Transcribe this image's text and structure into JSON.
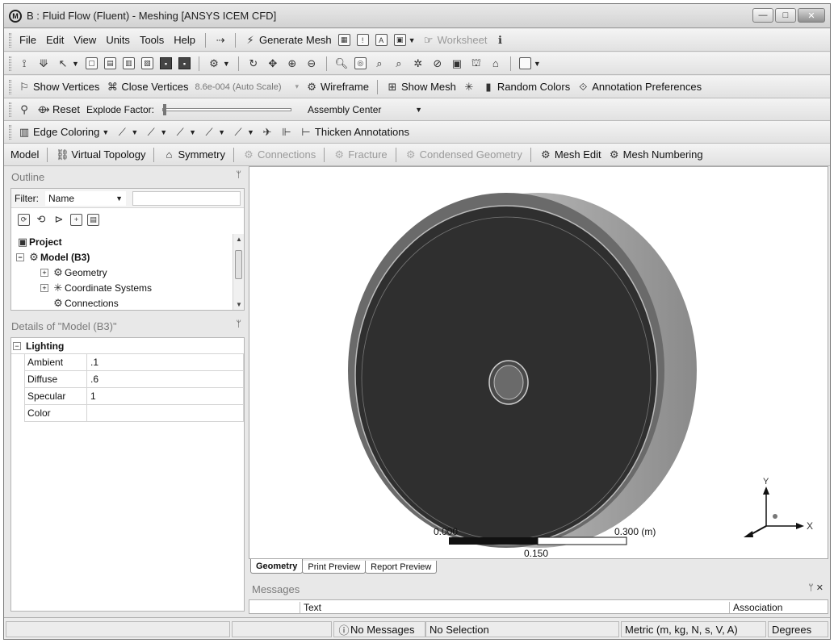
{
  "window": {
    "title": "B : Fluid Flow (Fluent) - Meshing [ANSYS ICEM CFD]",
    "app_icon": "M",
    "controls": [
      "—",
      "□",
      "✕"
    ]
  },
  "menu": {
    "items": [
      "File",
      "Edit",
      "View",
      "Units",
      "Tools",
      "Help"
    ],
    "generate_mesh": "Generate Mesh",
    "worksheet": "Worksheet"
  },
  "toolbar_display": {
    "show_vertices": "Show Vertices",
    "close_vertices": "Close Vertices",
    "scale_value": "8.6e-004 (Auto Scale)",
    "wireframe": "Wireframe",
    "show_mesh": "Show Mesh",
    "random_colors": "Random Colors",
    "annotation_prefs": "Annotation Preferences"
  },
  "toolbar_explode": {
    "reset": "Reset",
    "explode_factor": "Explode Factor:",
    "center_option": "Assembly Center"
  },
  "toolbar_edge": {
    "edge_coloring": "Edge Coloring",
    "thicken_annotations": "Thicken Annotations"
  },
  "context_toolbar": {
    "model": "Model",
    "virtual_topology": "Virtual Topology",
    "symmetry": "Symmetry",
    "connections": "Connections",
    "fracture": "Fracture",
    "condensed_geometry": "Condensed Geometry",
    "mesh_edit": "Mesh Edit",
    "mesh_numbering": "Mesh Numbering"
  },
  "outline": {
    "title": "Outline",
    "filter_label": "Filter:",
    "filter_value": "Name",
    "tree": {
      "project": "Project",
      "model": "Model (B3)",
      "geometry": "Geometry",
      "coordinate_systems": "Coordinate Systems",
      "connections": "Connections"
    }
  },
  "details": {
    "title": "Details of \"Model (B3)\"",
    "group": "Lighting",
    "rows": [
      {
        "key": "Ambient",
        "value": ".1"
      },
      {
        "key": "Diffuse",
        "value": ".6"
      },
      {
        "key": "Specular",
        "value": "1"
      },
      {
        "key": "Color",
        "value": ""
      }
    ]
  },
  "viewport": {
    "scale_start": "0.000",
    "scale_end": "0.300 (m)",
    "scale_mid": "0.150",
    "axis_y": "Y",
    "axis_x": "X",
    "colors": {
      "disk_face": "#2f2f2f",
      "disk_rim": "#9a9a9a",
      "hub": "#6a6a6a"
    }
  },
  "tabs": [
    "Geometry",
    "Print Preview",
    "Report Preview"
  ],
  "messages": {
    "title": "Messages",
    "controls": "ᛘ ✕",
    "col_text": "Text",
    "col_association": "Association"
  },
  "status": {
    "messages": "No Messages",
    "selection": "No Selection",
    "units": "Metric (m, kg, N, s, V, A)",
    "angle": "Degrees"
  }
}
